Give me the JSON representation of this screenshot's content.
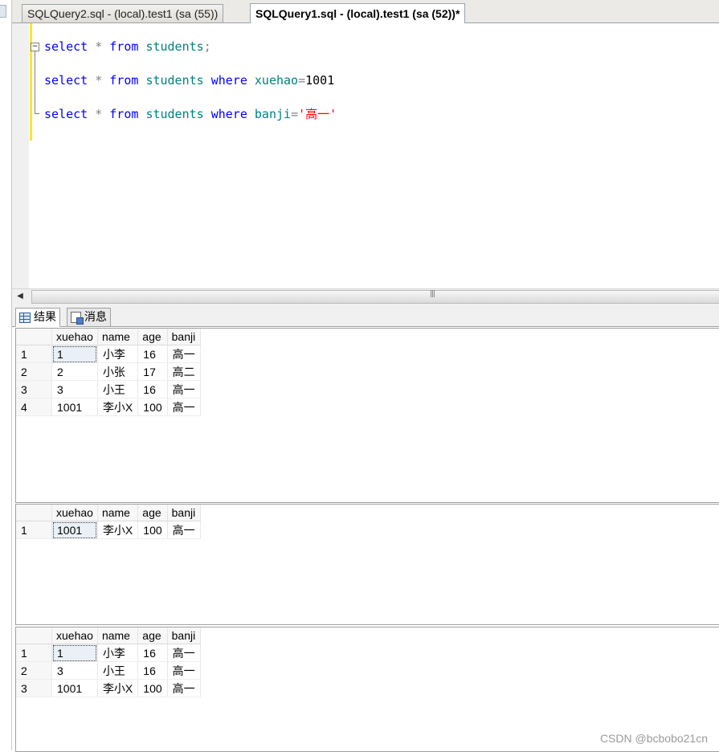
{
  "tabs": [
    {
      "title": "SQLQuery2.sql - (local).test1 (sa (55))",
      "active": false
    },
    {
      "title": "SQLQuery1.sql - (local).test1 (sa (52))*",
      "active": true
    }
  ],
  "editor": {
    "lines": [
      {
        "kw1": "select",
        "star": "*",
        "kw2": "from",
        "table": "students",
        "tail": ";"
      },
      {
        "kw1": "select",
        "star": "*",
        "kw2": "from",
        "table": "students",
        "kw3": "where",
        "col": "xuehao",
        "eq": "=",
        "val": "1001"
      },
      {
        "kw1": "select",
        "star": "*",
        "kw2": "from",
        "table": "students",
        "kw3": "where",
        "col": "banji",
        "eq": "=",
        "str": "'高一'"
      }
    ],
    "fold_symbol": "−"
  },
  "scrollbar": {
    "arrow": "◀",
    "grip": "|||"
  },
  "result_tabs": {
    "results_label": "结果",
    "messages_label": "消息",
    "results_icon": "grid-icon",
    "messages_icon": "message-icon"
  },
  "results": [
    {
      "columns": [
        "xuehao",
        "name",
        "age",
        "banji"
      ],
      "rows": [
        {
          "n": "1",
          "cells": [
            "1",
            "小李",
            "16",
            "高一"
          ]
        },
        {
          "n": "2",
          "cells": [
            "2",
            "小张",
            "17",
            "高二"
          ]
        },
        {
          "n": "3",
          "cells": [
            "3",
            "小王",
            "16",
            "高一"
          ]
        },
        {
          "n": "4",
          "cells": [
            "1001",
            "李小X",
            "100",
            "高一"
          ]
        }
      ]
    },
    {
      "columns": [
        "xuehao",
        "name",
        "age",
        "banji"
      ],
      "rows": [
        {
          "n": "1",
          "cells": [
            "1001",
            "李小X",
            "100",
            "高一"
          ]
        }
      ]
    },
    {
      "columns": [
        "xuehao",
        "name",
        "age",
        "banji"
      ],
      "rows": [
        {
          "n": "1",
          "cells": [
            "1",
            "小李",
            "16",
            "高一"
          ]
        },
        {
          "n": "2",
          "cells": [
            "3",
            "小王",
            "16",
            "高一"
          ]
        },
        {
          "n": "3",
          "cells": [
            "1001",
            "李小X",
            "100",
            "高一"
          ]
        }
      ]
    }
  ],
  "watermark": "CSDN @bcbobo21cn",
  "colors": {
    "keyword": "#0000ff",
    "identifier": "#008080",
    "string": "#ff0000",
    "change_bar": "#f5e832"
  }
}
